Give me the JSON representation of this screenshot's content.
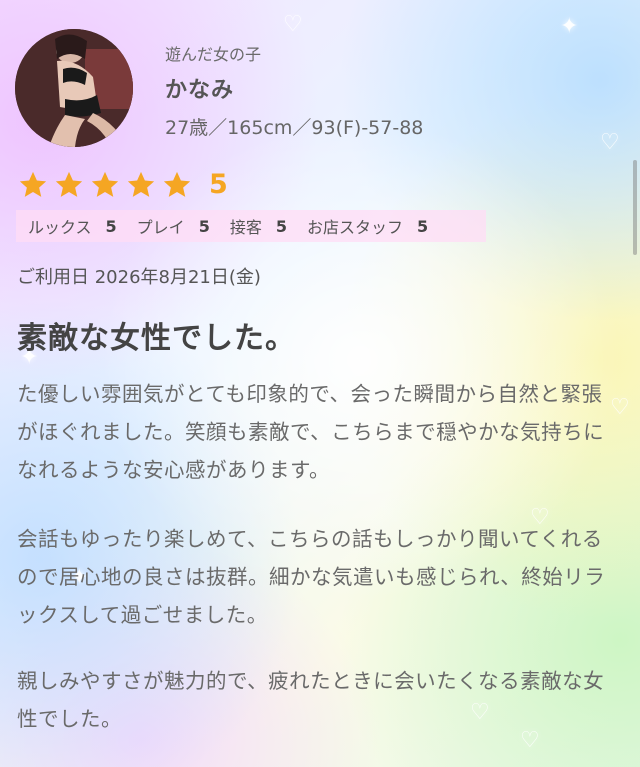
{
  "profile": {
    "label": "遊んだ女の子",
    "name": "かなみ",
    "stats": "27歳／165cm／93(F)-57-88"
  },
  "rating": {
    "stars": 5,
    "score": "5",
    "items": [
      {
        "label": "ルックス",
        "value": "5"
      },
      {
        "label": "プレイ",
        "value": "5"
      },
      {
        "label": "接客",
        "value": "5"
      },
      {
        "label": "お店スタッフ",
        "value": "5"
      }
    ]
  },
  "review": {
    "date": "ご利用日 2026年8月21日(金)",
    "title": "素敵な女性でした。",
    "paragraphs": [
      "た優しい雰囲気がとても印象的で、会った瞬間から自然と緊張がほぐれました。笑顔も素敵で、こちらまで穏やかな気持ちになれるような安心感があります。",
      "会話もゆったり楽しめて、こちらの話もしっかり聞いてくれるので居心地の良さは抜群。細かな気遣いも感じられ、終始リラックスして過ごせました。",
      "親しみやすさが魅力的で、疲れたときに会いたくなる素敵な女性でした。"
    ]
  },
  "colors": {
    "star": "#f5a623",
    "rating_bg": "#ffdcf5"
  }
}
